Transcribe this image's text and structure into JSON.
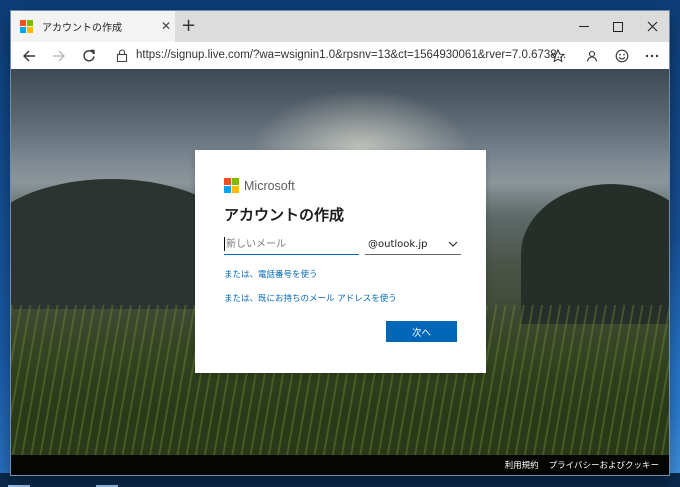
{
  "window": {
    "tab_title": "アカウントの作成",
    "tab_close": "✕",
    "new_tab": "+"
  },
  "toolbar": {
    "url": "https://signup.live.com/?wa=wsignin1.0&rpsnv=13&ct=1564930061&rver=7.0.6738...."
  },
  "card": {
    "brand": "Microsoft",
    "title": "アカウントの作成",
    "email_placeholder": "新しいメール",
    "domain": "@outlook.jp",
    "phone_link": "または、電話番号を使う",
    "existing_link": "または、既にお持ちのメール アドレスを使う",
    "next_button": "次へ"
  },
  "footer": {
    "terms": "利用規約",
    "privacy": "プライバシーおよびクッキー"
  },
  "colors": {
    "ms_red": "#f25022",
    "ms_green": "#7fba00",
    "ms_blue": "#00a4ef",
    "ms_yellow": "#ffb900",
    "accent": "#0067b8"
  }
}
